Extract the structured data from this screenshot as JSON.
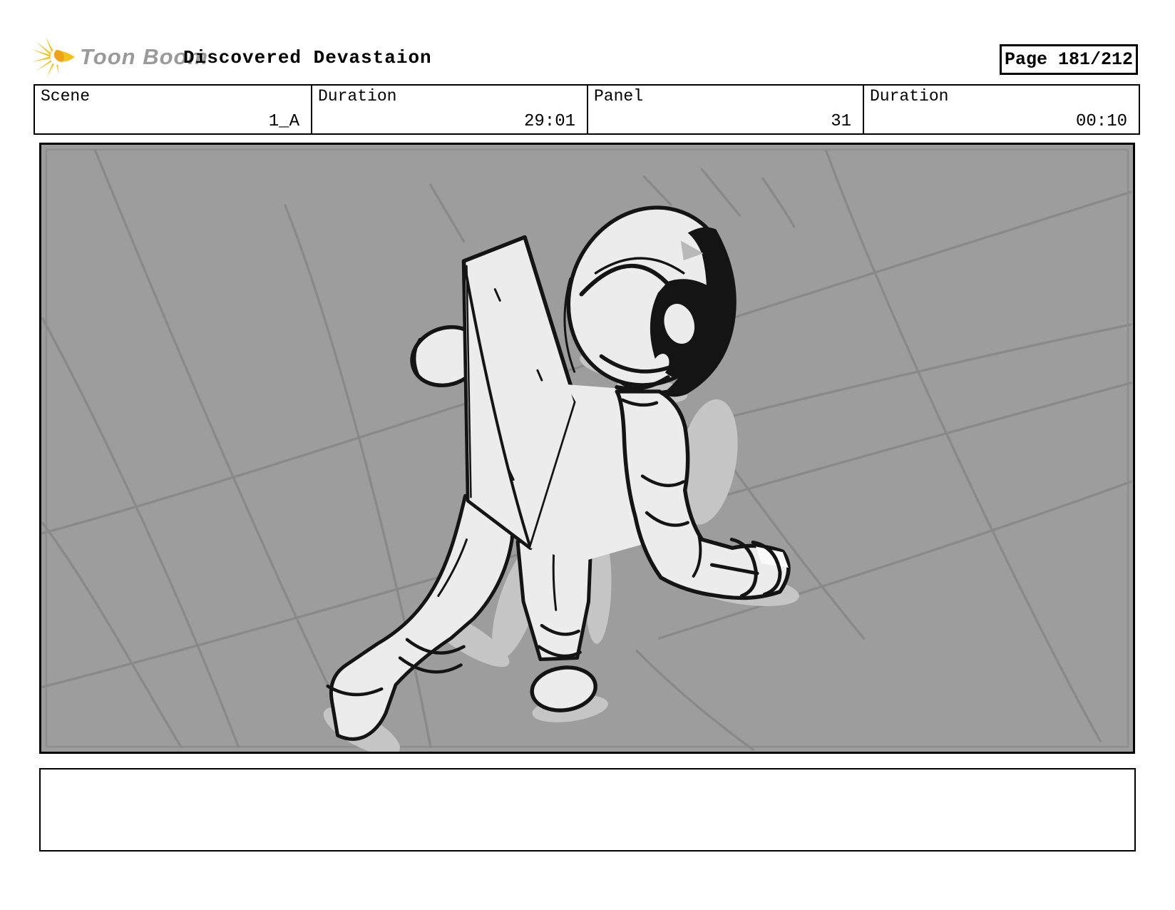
{
  "header": {
    "logo_text": "Toon Boom",
    "title": "Discovered Devastaion",
    "page_label": "Page 181/212"
  },
  "info_bar": {
    "cells": [
      {
        "label": "Scene",
        "value": "1_A"
      },
      {
        "label": "Duration",
        "value": "29:01"
      },
      {
        "label": "Panel",
        "value": "31"
      },
      {
        "label": "Duration",
        "value": "00:10"
      }
    ]
  },
  "panel": {
    "content_description": "Rough storyboard sketch of an astronaut with a boxy backpack, seen from behind and above, walking across a gray floor marked with perspective grid lines",
    "colors": {
      "floor_gray": "#9d9d9d",
      "grid_line": "#8a8a8a",
      "sketch_ink": "#141414",
      "figure_fill": "#ececec",
      "figure_fill_bright": "#f1f1f1",
      "figure_fill_dim": "#e6e6e6",
      "soft_shadow": "#c5c5c5",
      "frame_inner": "#8e8e8e",
      "logo_yellow": "#f2c31c",
      "logo_core": "#efa31a",
      "logo_text_gray": "#9a9a9a"
    }
  },
  "caption": {
    "text": ""
  }
}
